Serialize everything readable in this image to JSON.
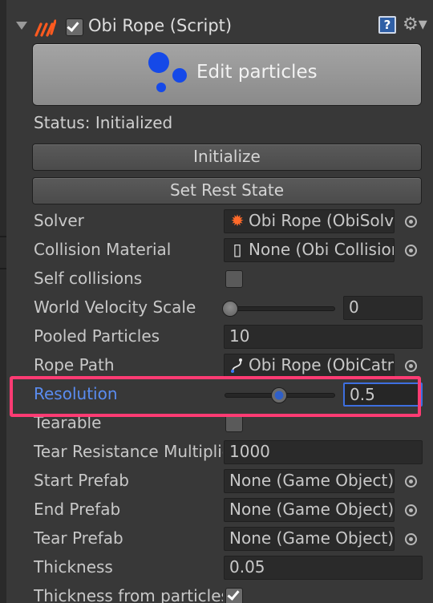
{
  "component": {
    "title": "Obi Rope (Script)",
    "enabled": true,
    "help_glyph": "?",
    "gear_glyph": "⚙▾"
  },
  "edit_button": {
    "label": "Edit particles"
  },
  "status": "Status: Initialized",
  "buttons": {
    "initialize": "Initialize",
    "set_rest_state": "Set Rest State"
  },
  "fields": {
    "solver": {
      "label": "Solver",
      "value": "Obi Rope (ObiSolver)",
      "icon": "solver-gear-icon"
    },
    "collision_material": {
      "label": "Collision Material",
      "value": "None (Obi Collision Material)",
      "icon": "document-icon"
    },
    "self_collisions": {
      "label": "Self collisions",
      "checked": false
    },
    "world_velocity_scale": {
      "label": "World Velocity Scale",
      "value": "0",
      "fraction": 0
    },
    "pooled_particles": {
      "label": "Pooled Particles",
      "value": "10"
    },
    "rope_path": {
      "label": "Rope Path",
      "value": "Obi Rope (ObiCatmullRomCurve)",
      "icon": "curve-icon"
    },
    "resolution": {
      "label": "Resolution",
      "value": "0.5",
      "fraction": 0.5
    },
    "tearable": {
      "label": "Tearable",
      "checked": false
    },
    "tear_resistance": {
      "label": "Tear Resistance Multiplier",
      "value": "1000"
    },
    "start_prefab": {
      "label": "Start Prefab",
      "value": "None (Game Object)"
    },
    "end_prefab": {
      "label": "End Prefab",
      "value": "None (Game Object)"
    },
    "tear_prefab": {
      "label": "Tear Prefab",
      "value": "None (Game Object)"
    },
    "thickness": {
      "label": "Thickness",
      "value": "0.05"
    },
    "thickness_from_particles": {
      "label": "Thickness from particles",
      "checked": true
    }
  },
  "colors": {
    "accent_blue": "#5a8cf0",
    "highlight_pink": "#ff3b73",
    "particle_blue": "#1549e8"
  }
}
